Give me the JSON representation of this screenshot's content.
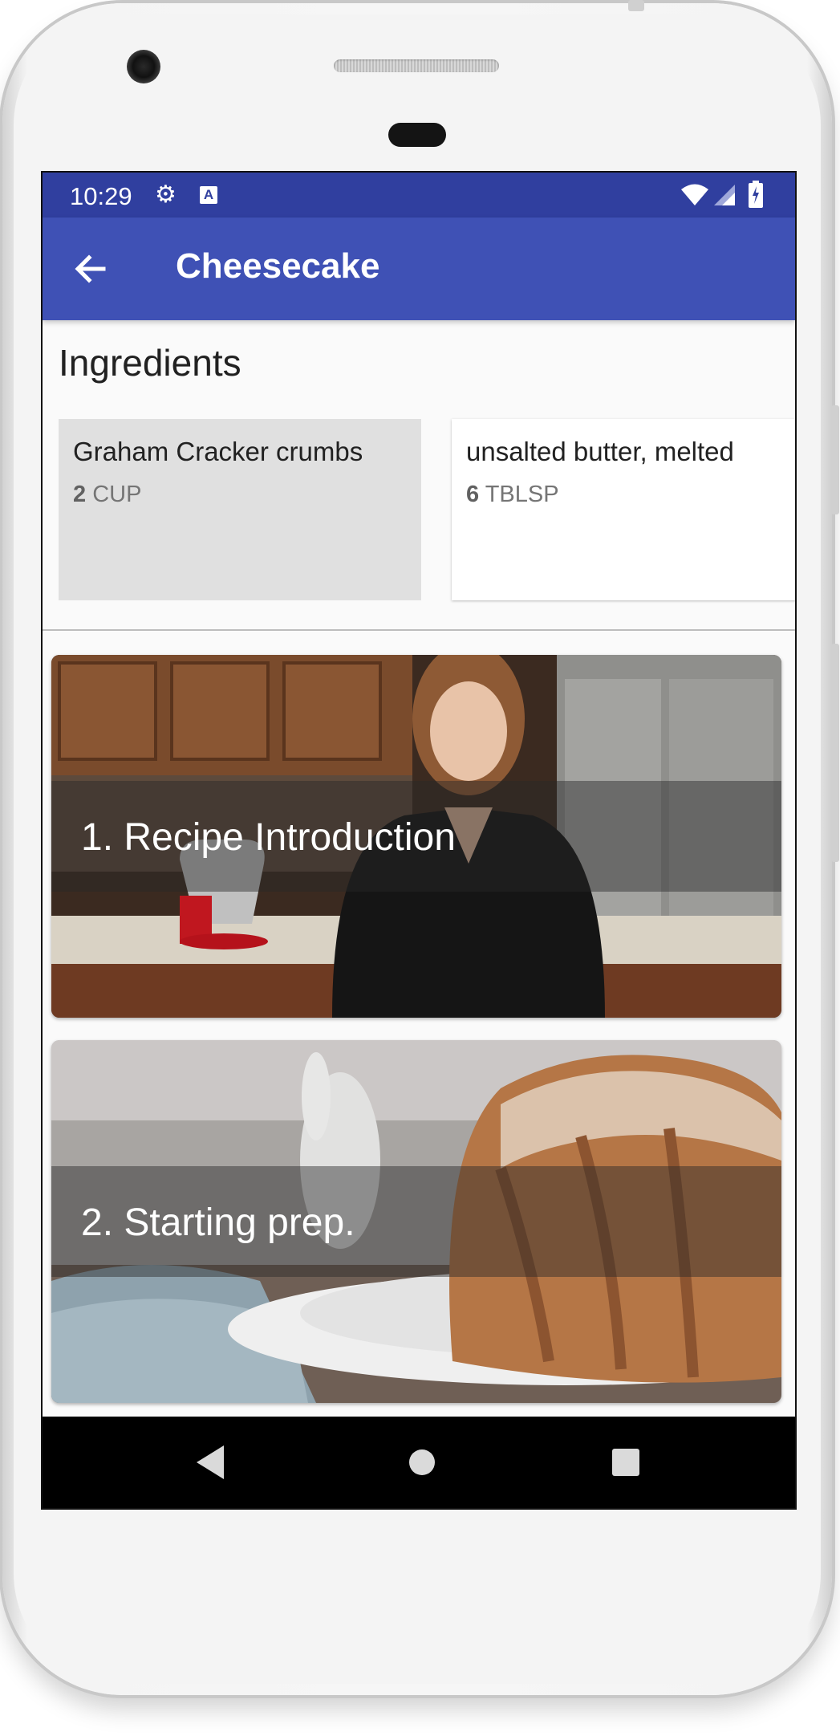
{
  "status_bar": {
    "time": "10:29",
    "icons": [
      "gear-icon",
      "a-notification-icon",
      "wifi-icon",
      "cell-signal-icon",
      "battery-icon"
    ]
  },
  "app_bar": {
    "title": "Cheesecake",
    "back_icon": "arrow-back-icon",
    "color": "#3f51b5",
    "status_color": "#303f9f"
  },
  "ingredients": {
    "heading": "Ingredients",
    "items": [
      {
        "name": "Graham Cracker crumbs",
        "quantity": "2",
        "unit": "CUP",
        "selected": true
      },
      {
        "name": "unsalted butter, melted",
        "quantity": "6",
        "unit": "TBLSP",
        "selected": false
      }
    ]
  },
  "steps": [
    {
      "label": "1. Recipe Introduction"
    },
    {
      "label": "2. Starting prep."
    }
  ],
  "nav_bar": {
    "icons": [
      "back-triangle-icon",
      "home-circle-icon",
      "recents-square-icon"
    ]
  }
}
